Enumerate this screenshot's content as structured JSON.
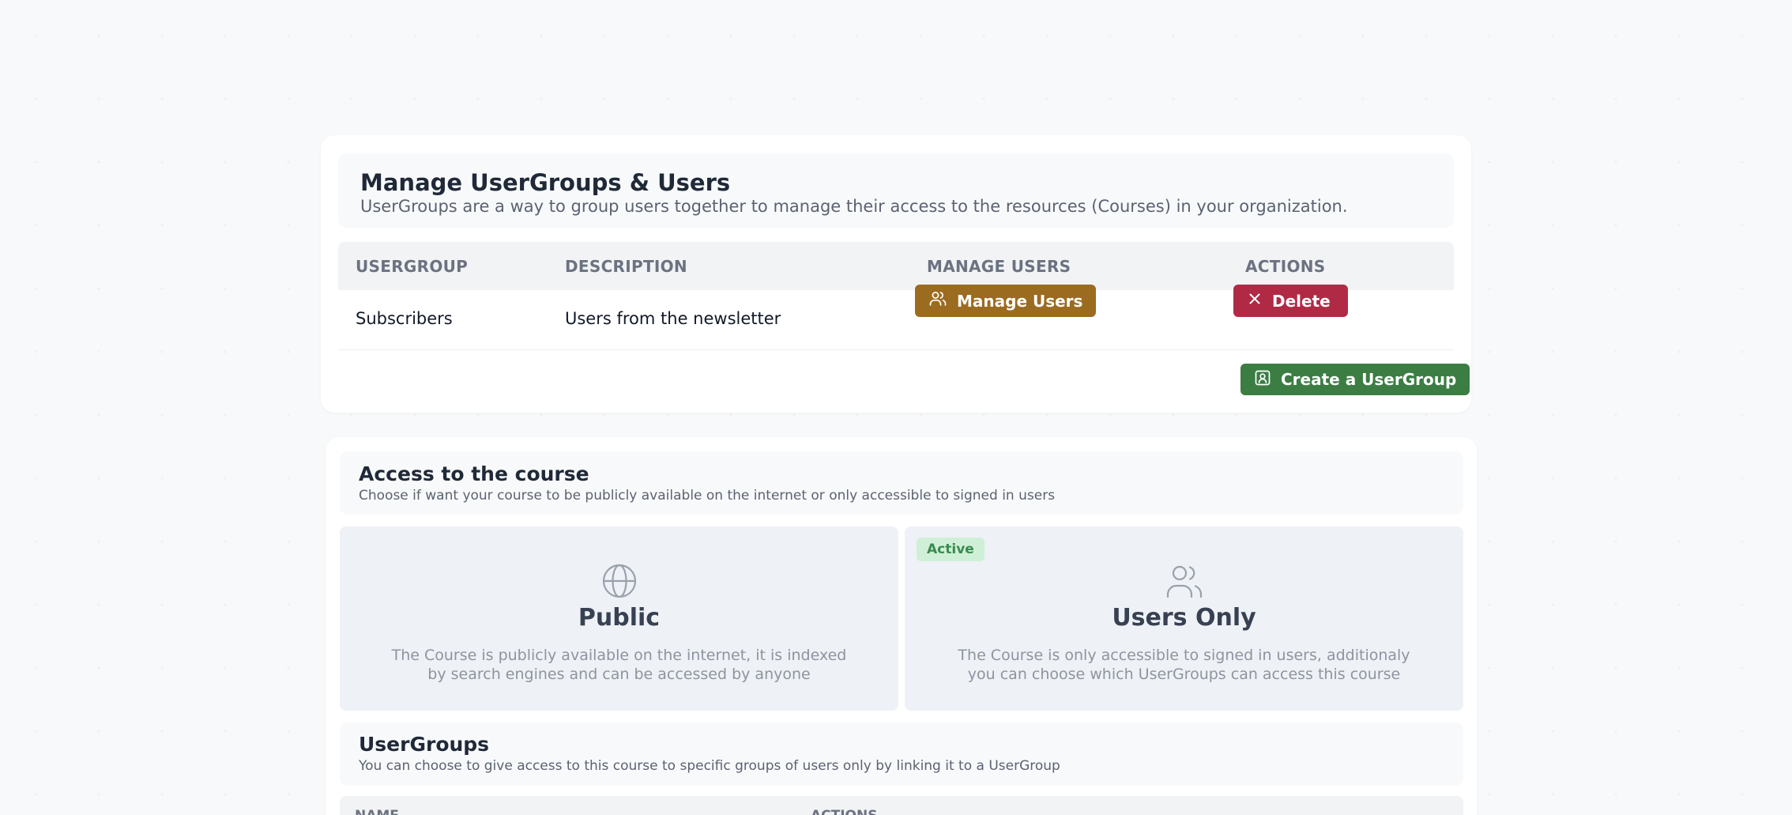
{
  "usergroups_panel": {
    "title": "Manage UserGroups & Users",
    "description": "UserGroups are a way to group users together to manage their access to the resources (Courses) in your organization.",
    "columns": [
      "USERGROUP",
      "DESCRIPTION",
      "MANAGE USERS",
      "ACTIONS"
    ],
    "rows": [
      {
        "usergroup": "Subscribers",
        "description": "Users from the newsletter",
        "manage_label": "Manage Users",
        "delete_label": "Delete"
      }
    ],
    "create_label": "Create a UserGroup"
  },
  "access_panel": {
    "title": "Access to the course",
    "description": "Choose if want your course to be publicly available on the internet or only accessible to signed in users",
    "options": [
      {
        "icon": "globe-icon",
        "title": "Public",
        "description": "The Course is publicly available on the internet, it is indexed by search engines and can be accessed by anyone",
        "active": false
      },
      {
        "icon": "users-icon",
        "title": "Users Only",
        "description": "The Course is only accessible to signed in users, additionaly you can choose which UserGroups can access this course",
        "active": true,
        "badge": "Active"
      }
    ]
  },
  "course_usergroups": {
    "title": "UserGroups",
    "description": "You can choose to give access to this course to specific groups of users only by linking it to a UserGroup",
    "columns": [
      "NAME",
      "ACTIONS"
    ]
  },
  "colors": {
    "manage_button": "#9b6b1f",
    "delete_button": "#b02a46",
    "create_button": "#3b7d43",
    "active_badge_bg": "#cff0d7",
    "active_badge_text": "#3a8a50",
    "option_bg": "#eef1f6"
  }
}
